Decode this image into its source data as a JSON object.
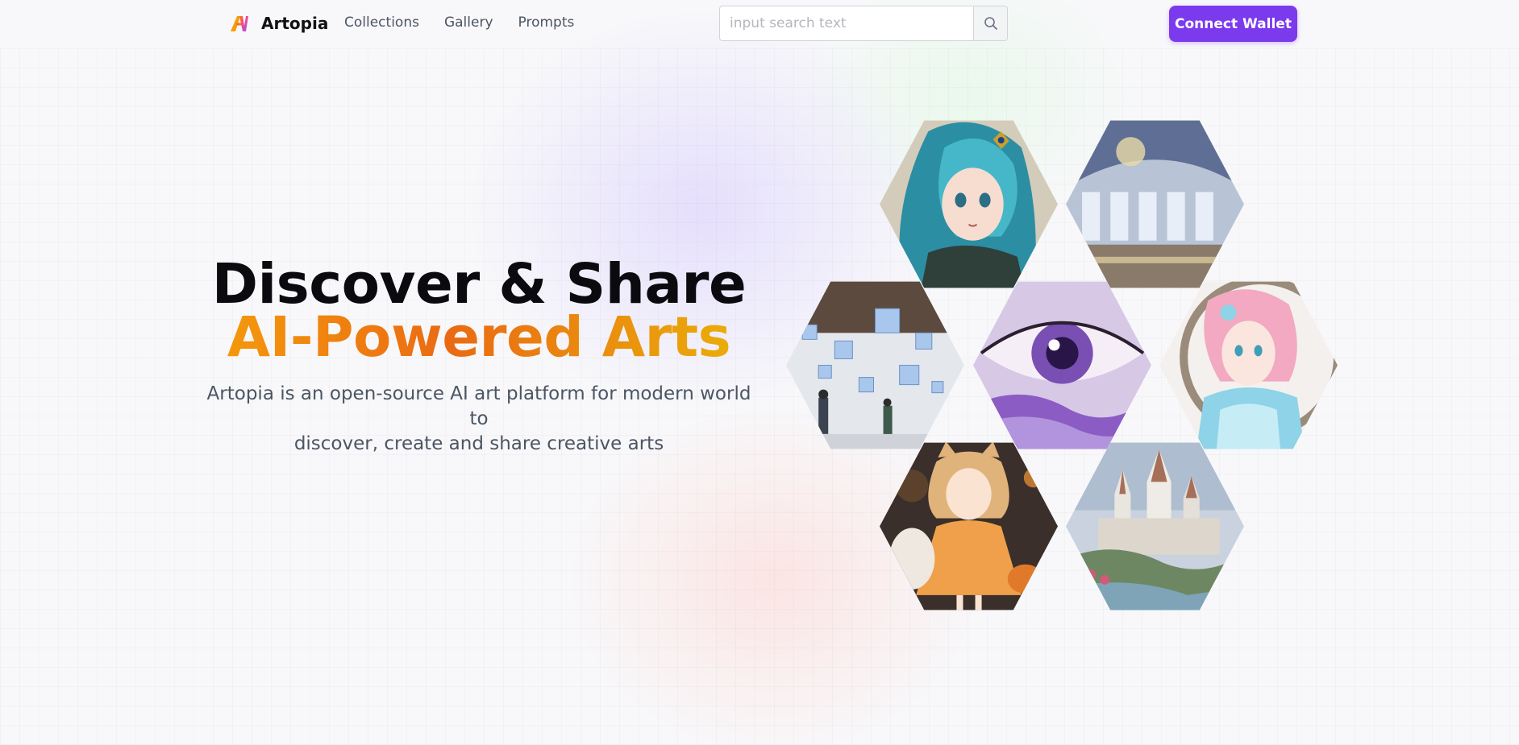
{
  "header": {
    "brand": "Artopia",
    "nav": [
      {
        "label": "Collections"
      },
      {
        "label": "Gallery"
      },
      {
        "label": "Prompts"
      }
    ],
    "search": {
      "placeholder": "input search text",
      "value": "",
      "icon": "search-icon"
    },
    "wallet_button": "Connect Wallet",
    "accent_color": "#7c3aed"
  },
  "hero": {
    "title_line1": "Discover & Share",
    "title_line2": "AI-Powered Arts",
    "subtitle_line1": "Artopia is an open-source AI art platform for modern world to",
    "subtitle_line2": "discover, create and share creative arts",
    "gradient_colors": [
      "#f59e0b",
      "#ea6a14",
      "#eab308"
    ]
  },
  "gallery": {
    "images": [
      {
        "name": "teal-haired-elf-girl"
      },
      {
        "name": "grand-hall-dome"
      },
      {
        "name": "floating-cubes-exhibition"
      },
      {
        "name": "purple-eye-closeup"
      },
      {
        "name": "pink-haired-girl"
      },
      {
        "name": "girl-orange-dress-with-cat"
      },
      {
        "name": "fantasy-castle"
      }
    ]
  }
}
